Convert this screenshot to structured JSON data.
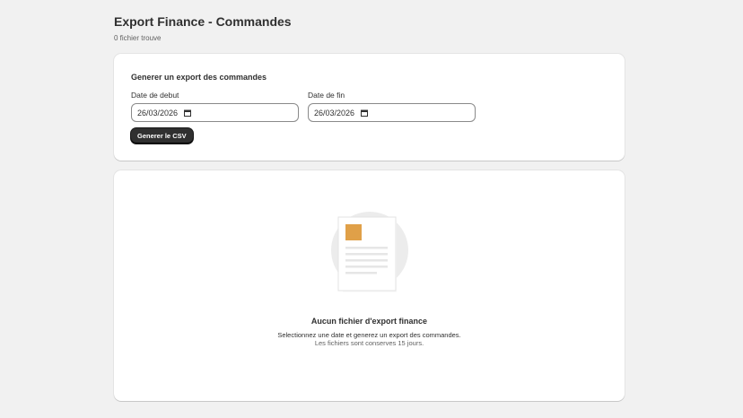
{
  "header": {
    "title": "Export Finance - Commandes",
    "subtitle": "0 fichier trouve"
  },
  "form": {
    "heading": "Generer un export des commandes",
    "start_label": "Date de debut",
    "start_value": "26/03/2026",
    "end_label": "Date de fin",
    "end_value": "26/03/2026",
    "generate_button": "Generer le CSV",
    "icons": {
      "calendar": "calendar-icon"
    }
  },
  "empty_state": {
    "title": "Aucun fichier d'export finance",
    "description": "Selectionnez une date et generez un export des commandes.",
    "note": "Les fichiers sont conserves 15 jours.",
    "illustration": "document-illustration",
    "accent_color": "#e0a048"
  },
  "colors": {
    "background": "#f1f1f1",
    "card": "#ffffff",
    "button": "#303030"
  }
}
